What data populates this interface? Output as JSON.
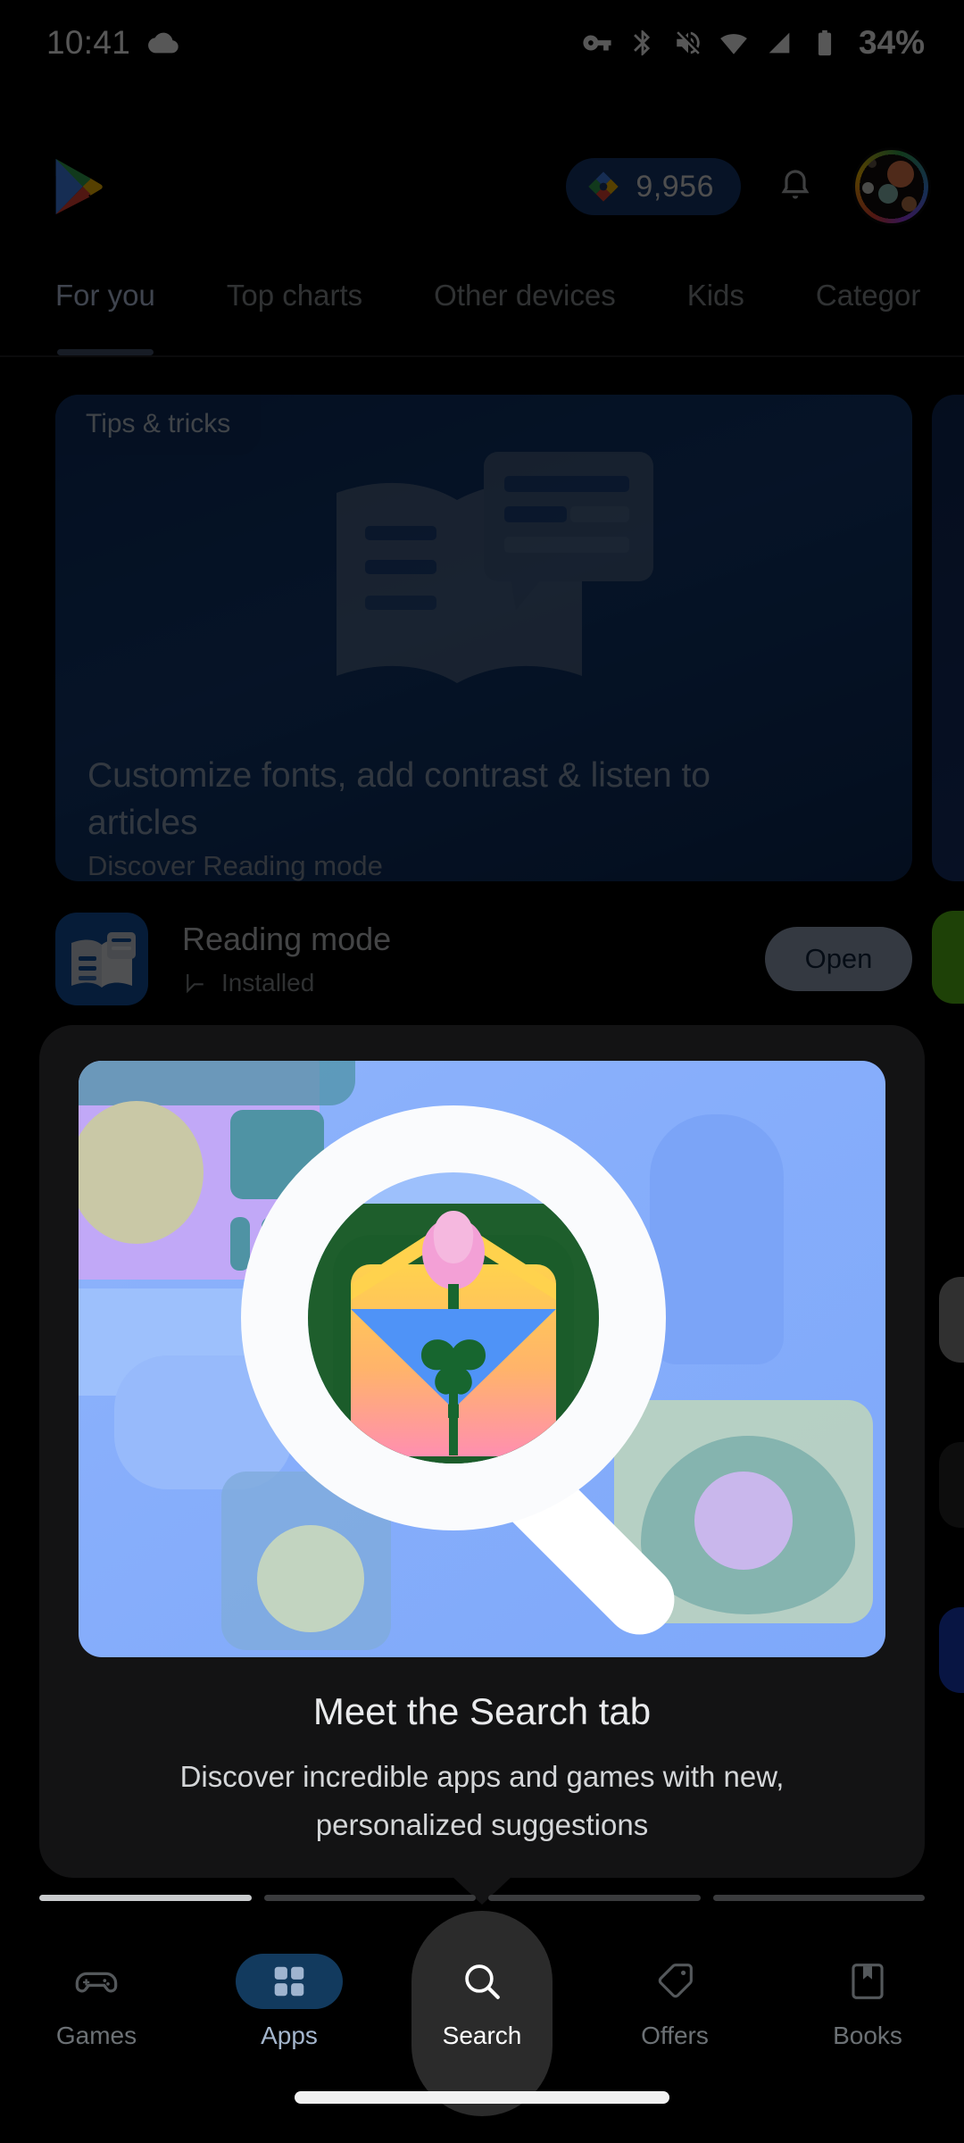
{
  "status_bar": {
    "time": "10:41",
    "battery_percent": "34%",
    "icons": [
      "cloud-icon",
      "vpn-key-icon",
      "bluetooth-icon",
      "volume-off-icon",
      "wifi-icon",
      "cell-signal-icon",
      "battery-icon"
    ]
  },
  "header": {
    "logo": "google-play-logo",
    "points_value": "9,956",
    "points_icon": "play-points-diamond-icon",
    "notifications_icon": "bell-icon",
    "avatar": "account-avatar"
  },
  "tabs": {
    "active_index": 0,
    "items": [
      {
        "label": "For you"
      },
      {
        "label": "Top charts"
      },
      {
        "label": "Other devices"
      },
      {
        "label": "Kids"
      },
      {
        "label": "Categor"
      }
    ]
  },
  "promo_card": {
    "badge": "Tips & tricks",
    "title": "Customize fonts, add contrast & listen to articles",
    "subtitle": "Discover Reading mode",
    "illustration": "open-book-with-article-card-icon"
  },
  "app_row": {
    "name": "Reading mode",
    "status": "Installed",
    "status_icon": "installed-check-icon",
    "icon": "reading-mode-app-icon",
    "action_label": "Open"
  },
  "tooltip": {
    "title": "Meet the Search tab",
    "body": "Discover incredible apps and games with new, personalized suggestions",
    "image": "search-magnifier-illustration",
    "progress": {
      "total": 4,
      "active_index": 0
    }
  },
  "bottom_nav": {
    "active_label": "Apps",
    "spotlight_label": "Search",
    "items": [
      {
        "label": "Games",
        "icon": "gamepad-icon"
      },
      {
        "label": "Apps",
        "icon": "apps-grid-icon"
      },
      {
        "label": "Search",
        "icon": "search-icon"
      },
      {
        "label": "Offers",
        "icon": "tag-icon"
      },
      {
        "label": "Books",
        "icon": "book-bookmark-icon"
      }
    ]
  },
  "system": {
    "gesture_bar": "home-gesture-bar"
  },
  "colors": {
    "background": "#000000",
    "promo_card": "#123a72",
    "points_pill": "#17386f",
    "open_button": "#9aa7bf",
    "tooltip_card": "#131314",
    "apps_pill": "#123a5e"
  }
}
